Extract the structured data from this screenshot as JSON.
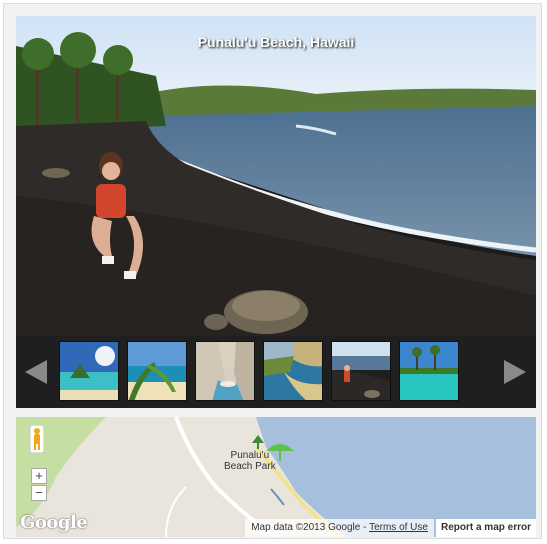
{
  "gallery": {
    "caption": "Punalu'u Beach, Hawaii",
    "prev_icon": "triangle-left",
    "next_icon": "triangle-right",
    "thumbnails": [
      {
        "name": "thumb-tropical-island"
      },
      {
        "name": "thumb-palm-beach"
      },
      {
        "name": "thumb-cove-cliffs"
      },
      {
        "name": "thumb-coastline-sunset"
      },
      {
        "name": "thumb-black-sand-beach"
      },
      {
        "name": "thumb-lagoon-palms"
      }
    ]
  },
  "map": {
    "place_label_line1": "Punalu'u",
    "place_label_line2": "Beach Park",
    "zoom_in": "+",
    "zoom_out": "−",
    "logo": "Google",
    "map_data": "Map data ©2013 Google -",
    "terms": "Terms of Use",
    "report": "Report a map error",
    "colors": {
      "ocean": "#a5bfdd",
      "land": "#e9e5dc",
      "park": "#c5dea2",
      "road": "#f5e27a"
    }
  }
}
